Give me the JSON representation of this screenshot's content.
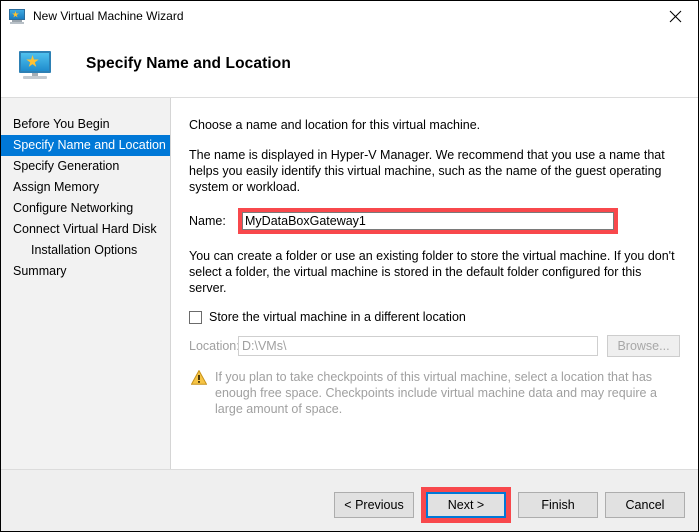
{
  "window": {
    "title": "New Virtual Machine Wizard",
    "title_icon": "virtual-machine-monitor-icon",
    "close_label": "✕"
  },
  "header": {
    "title": "Specify Name and Location",
    "icon": "virtual-machine-monitor-icon"
  },
  "sidebar": {
    "items": [
      {
        "label": "Before You Begin",
        "selected": false,
        "indent": false
      },
      {
        "label": "Specify Name and Location",
        "selected": true,
        "indent": false
      },
      {
        "label": "Specify Generation",
        "selected": false,
        "indent": false
      },
      {
        "label": "Assign Memory",
        "selected": false,
        "indent": false
      },
      {
        "label": "Configure Networking",
        "selected": false,
        "indent": false
      },
      {
        "label": "Connect Virtual Hard Disk",
        "selected": false,
        "indent": false
      },
      {
        "label": "Installation Options",
        "selected": false,
        "indent": true
      },
      {
        "label": "Summary",
        "selected": false,
        "indent": false
      }
    ]
  },
  "content": {
    "intro": "Choose a name and location for this virtual machine.",
    "description": "The name is displayed in Hyper-V Manager. We recommend that you use a name that helps you easily identify this virtual machine, such as the name of the guest operating system or workload.",
    "name_label": "Name:",
    "name_value": "MyDataBoxGateway1",
    "folder_description": "You can create a folder or use an existing folder to store the virtual machine. If you don't select a folder, the virtual machine is stored in the default folder configured for this server.",
    "store_checkbox_label": "Store the virtual machine in a different location",
    "store_checkbox_checked": false,
    "location_label": "Location:",
    "location_value": "D:\\VMs\\",
    "browse_label": "Browse...",
    "warning_icon": "warning-triangle-icon",
    "warning_text": "If you plan to take checkpoints of this virtual machine, select a location that has enough free space. Checkpoints include virtual machine data and may require a large amount of space."
  },
  "footer": {
    "previous_label": "< Previous",
    "next_label": "Next >",
    "finish_label": "Finish",
    "cancel_label": "Cancel"
  },
  "colors": {
    "selection_blue": "#0078D7",
    "annotation_red": "#F8484C",
    "warning_amber": "#F0A30A",
    "footer_gray": "#EFEFEF",
    "sidebar_gray": "#F2F2F2"
  }
}
